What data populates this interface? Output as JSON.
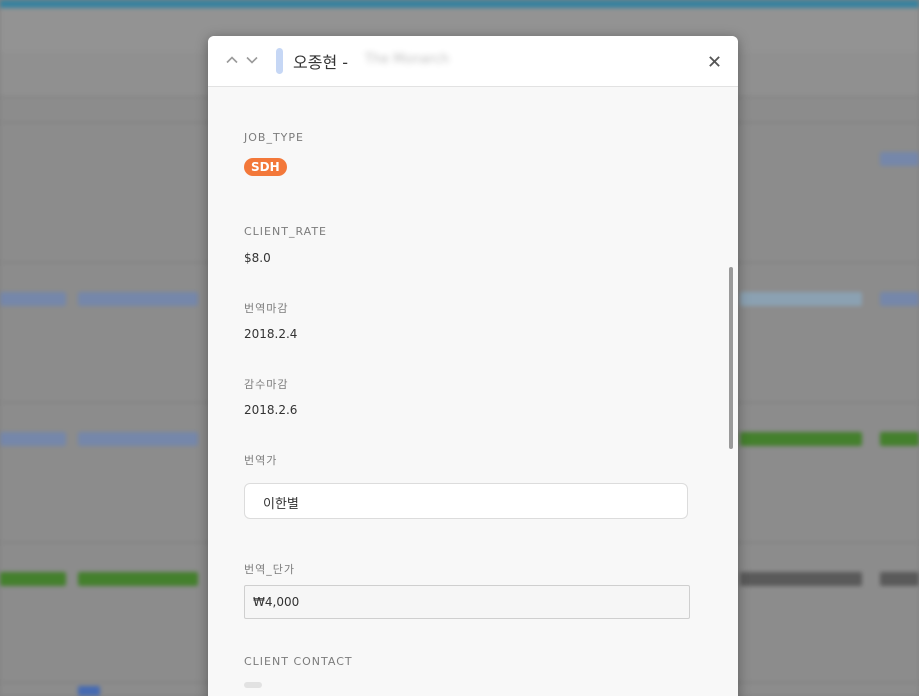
{
  "modal": {
    "title": "오종현  -",
    "title_obscured": "The Monarch",
    "record_color": "#c6d7f5",
    "nav": {
      "prev_icon": "chevron-up-icon",
      "next_icon": "chevron-down-icon"
    },
    "close_icon": "close-icon"
  },
  "fields": {
    "job_type": {
      "label": "JOB_TYPE",
      "value": "SDH",
      "color": "#f3783a"
    },
    "client_rate": {
      "label": "CLIENT_RATE",
      "value": "$8.0"
    },
    "translation_deadline": {
      "label": "번역마감",
      "value": "2018.2.4"
    },
    "review_deadline": {
      "label": "감수마감",
      "value": "2018.2.6"
    },
    "translator": {
      "label": "번역가",
      "value": "이한별"
    },
    "translation_unit_price": {
      "label": "번역_단가",
      "value": "₩4,000"
    },
    "client_contact": {
      "label": "CLIENT CONTACT"
    }
  },
  "background": {
    "toolbar_text": "",
    "accent": "#2d8fb5",
    "cell_colors": [
      "#7e96c4",
      "#3d8c1e",
      "#5a5a5a",
      "#9bb9cf"
    ]
  }
}
